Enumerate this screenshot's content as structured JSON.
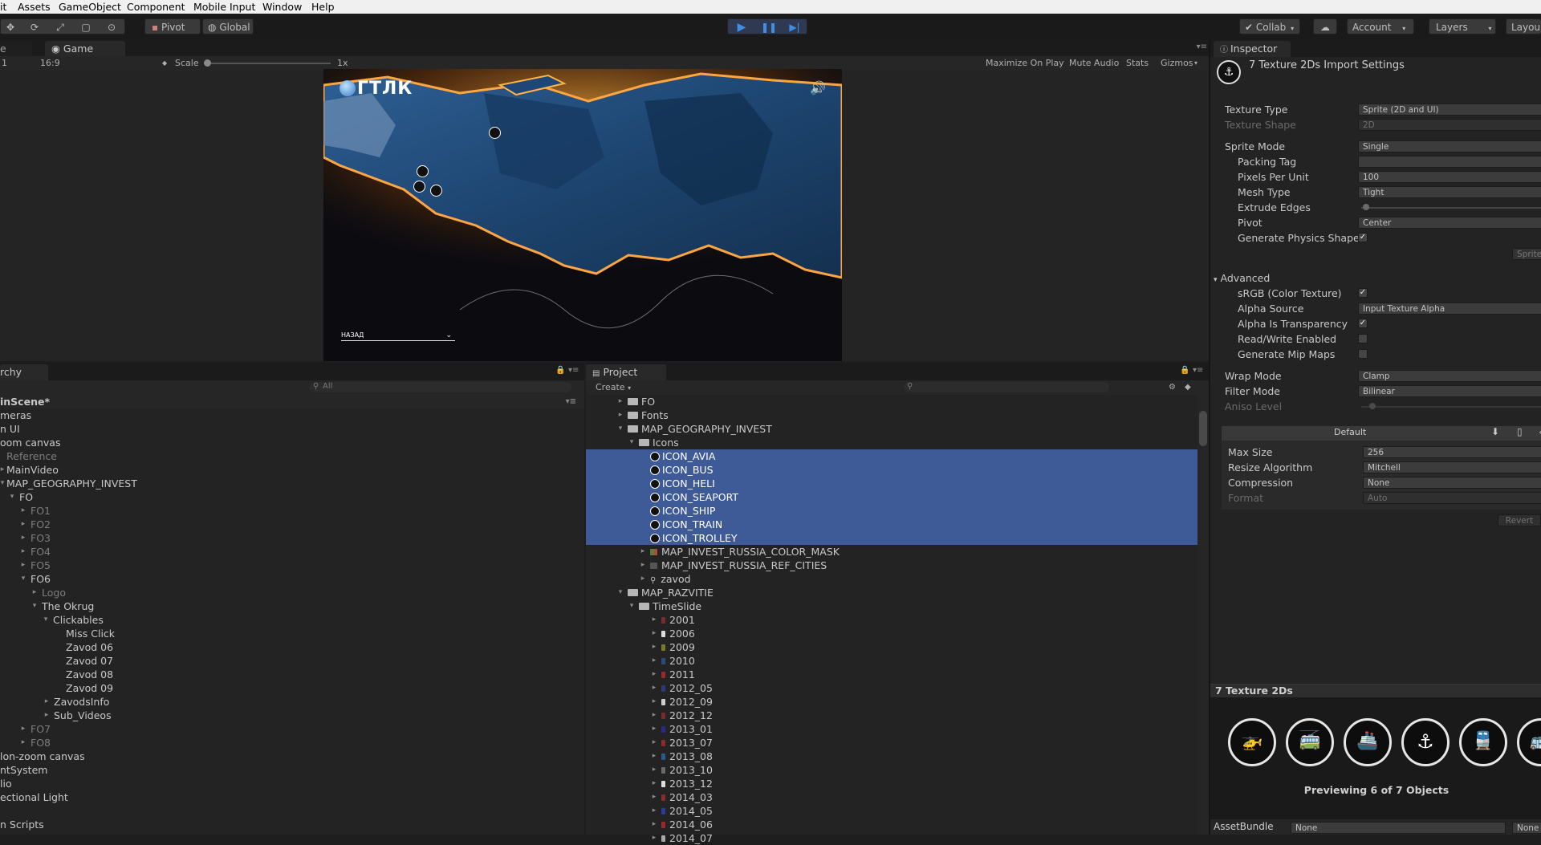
{
  "menu": [
    "it",
    "Assets",
    "GameObject",
    "Component",
    "Mobile Input",
    "Window",
    "Help"
  ],
  "toolbar": {
    "pivot_label": "Pivot",
    "global_label": "Global",
    "collab_label": "Collab",
    "account_label": "Account",
    "layers_label": "Layers",
    "layout_label": "Layou"
  },
  "game_view": {
    "tab_left": "e",
    "tab_label": "Game",
    "display_label": "1",
    "aspect_label": "16:9",
    "scale_label": "Scale",
    "scale_value": "1x",
    "maximize_label": "Maximize On Play",
    "mute_label": "Mute Audio",
    "stats_label": "Stats",
    "gizmos_label": "Gizmos",
    "logo_text": "ГТЛК",
    "back_label": "НАЗАД"
  },
  "hierarchy": {
    "tab_label": "rchy",
    "search_placeholder": "All",
    "rows": [
      {
        "text": "inScene*"
      },
      {
        "text": "meras"
      },
      {
        "text": "n UI"
      },
      {
        "text": "oom canvas"
      },
      {
        "text": "Reference"
      },
      {
        "text": "MainVideo"
      },
      {
        "text": "MAP_GEOGRAPHY_INVEST"
      },
      {
        "text": "FO"
      },
      {
        "text": "FO1"
      },
      {
        "text": "FO2"
      },
      {
        "text": "FO3"
      },
      {
        "text": "FO4"
      },
      {
        "text": "FO5"
      },
      {
        "text": "FO6"
      },
      {
        "text": "Logo"
      },
      {
        "text": "The Okrug"
      },
      {
        "text": "Clickables"
      },
      {
        "text": "Miss Click"
      },
      {
        "text": "Zavod 06"
      },
      {
        "text": "Zavod 07"
      },
      {
        "text": "Zavod 08"
      },
      {
        "text": "Zavod 09"
      },
      {
        "text": "ZavodsInfo"
      },
      {
        "text": "Sub_Videos"
      },
      {
        "text": "FO7"
      },
      {
        "text": "FO8"
      },
      {
        "text": "lon-zoom canvas"
      },
      {
        "text": "ntSystem"
      },
      {
        "text": "lio"
      },
      {
        "text": "ectional Light"
      },
      {
        "text": ""
      },
      {
        "text": "n Scripts"
      }
    ]
  },
  "project": {
    "tab_label": "Project",
    "create_label": "Create",
    "rows": [
      {
        "text": "FO"
      },
      {
        "text": "Fonts"
      },
      {
        "text": "MAP_GEOGRAPHY_INVEST"
      },
      {
        "text": "Icons"
      },
      {
        "text": "ICON_AVIA"
      },
      {
        "text": "ICON_BUS"
      },
      {
        "text": "ICON_HELI"
      },
      {
        "text": "ICON_SEAPORT"
      },
      {
        "text": "ICON_SHIP"
      },
      {
        "text": "ICON_TRAIN"
      },
      {
        "text": "ICON_TROLLEY"
      },
      {
        "text": "MAP_INVEST_RUSSIA_COLOR_MASK"
      },
      {
        "text": "MAP_INVEST_RUSSIA_REF_CITIES"
      },
      {
        "text": "zavod"
      },
      {
        "text": "MAP_RAZVITIE"
      },
      {
        "text": "TimeSlide"
      },
      {
        "text": "2001"
      },
      {
        "text": "2006"
      },
      {
        "text": "2009"
      },
      {
        "text": "2010"
      },
      {
        "text": "2011"
      },
      {
        "text": "2012_05"
      },
      {
        "text": "2012_09"
      },
      {
        "text": "2012_12"
      },
      {
        "text": "2013_01"
      },
      {
        "text": "2013_07"
      },
      {
        "text": "2013_08"
      },
      {
        "text": "2013_10"
      },
      {
        "text": "2013_12"
      },
      {
        "text": "2014_03"
      },
      {
        "text": "2014_05"
      },
      {
        "text": "2014_06"
      },
      {
        "text": "2014_07"
      }
    ]
  },
  "inspector": {
    "tab_label": "Inspector",
    "title": "7 Texture 2Ds Import Settings",
    "texture_type_label": "Texture Type",
    "texture_type": "Sprite (2D and UI)",
    "texture_shape_label": "Texture Shape",
    "texture_shape": "2D",
    "sprite_mode_label": "Sprite Mode",
    "sprite_mode": "Single",
    "packing_tag_label": "Packing Tag",
    "packing_tag": "",
    "ppu_label": "Pixels Per Unit",
    "ppu": "100",
    "mesh_type_label": "Mesh Type",
    "mesh_type": "Tight",
    "extrude_label": "Extrude Edges",
    "pivot_label": "Pivot",
    "pivot": "Center",
    "gen_physics_label": "Generate Physics Shape",
    "sprite_editor_label": "Sprite",
    "advanced_label": "Advanced",
    "srgb_label": "sRGB (Color Texture)",
    "alpha_source_label": "Alpha Source",
    "alpha_source": "Input Texture Alpha",
    "alpha_transp_label": "Alpha Is Transparency",
    "readwrite_label": "Read/Write Enabled",
    "mipmaps_label": "Generate Mip Maps",
    "wrap_label": "Wrap Mode",
    "wrap": "Clamp",
    "filter_label": "Filter Mode",
    "filter": "Bilinear",
    "aniso_label": "Aniso Level",
    "platform_label": "Default",
    "max_size_label": "Max Size",
    "max_size": "256",
    "resize_label": "Resize Algorithm",
    "resize": "Mitchell",
    "compression_label": "Compression",
    "compression": "None",
    "format_label": "Format",
    "format": "Auto",
    "revert_label": "Revert",
    "preview_title": "7 Texture 2Ds",
    "preview_caption": "Previewing 6 of 7 Objects",
    "assetbundle_label": "AssetBundle",
    "assetbundle": "None",
    "assetbundle_variant": "None"
  }
}
